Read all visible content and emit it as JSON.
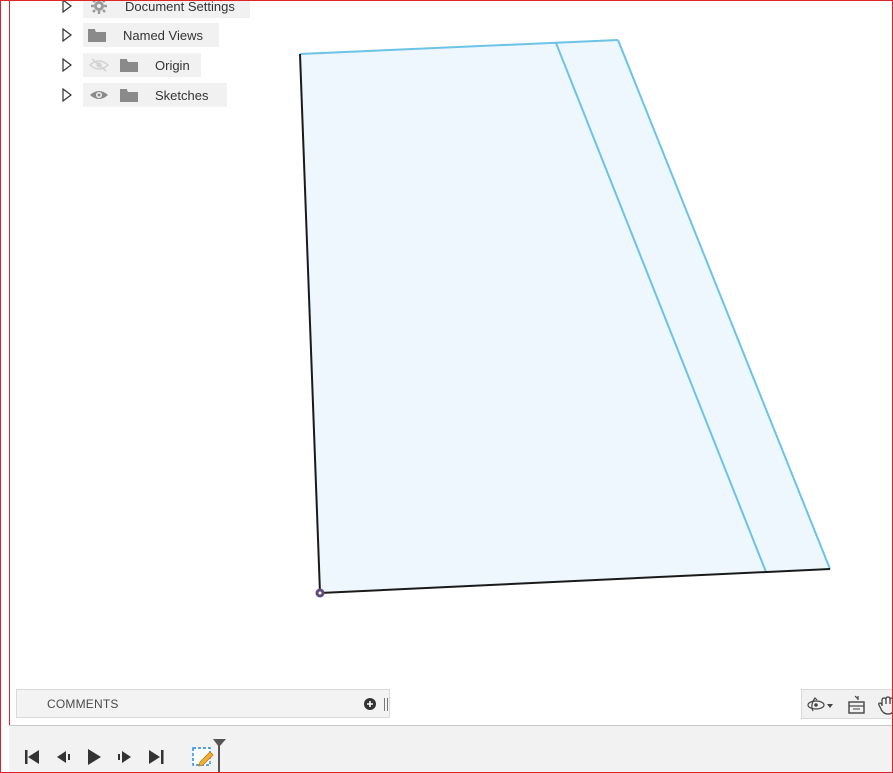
{
  "browser": {
    "items": [
      {
        "label": "Document Settings",
        "icon": "gear-icon",
        "visibility": "none"
      },
      {
        "label": "Named Views",
        "icon": "folder-icon",
        "visibility": "none"
      },
      {
        "label": "Origin",
        "icon": "folder-icon",
        "visibility": "hidden-eye-icon"
      },
      {
        "label": "Sketches",
        "icon": "folder-icon",
        "visibility": "eye-icon"
      }
    ]
  },
  "comments": {
    "label": "COMMENTS"
  },
  "nav_toolbar": {
    "icons": [
      "orbit-icon",
      "look-at-icon",
      "pan-icon"
    ]
  },
  "timeline": {
    "controls": [
      "go-to-start-icon",
      "step-back-icon",
      "play-icon",
      "step-forward-icon",
      "go-to-end-icon"
    ],
    "features": [
      "sketch-feature-icon"
    ]
  },
  "colors": {
    "frame_border": "#d9262b",
    "sketch_fill": "#eef7fd",
    "sketch_line": "#6cc3e8",
    "sketch_edge": "#1a1a1a",
    "origin_point": "#5d4a7c"
  }
}
